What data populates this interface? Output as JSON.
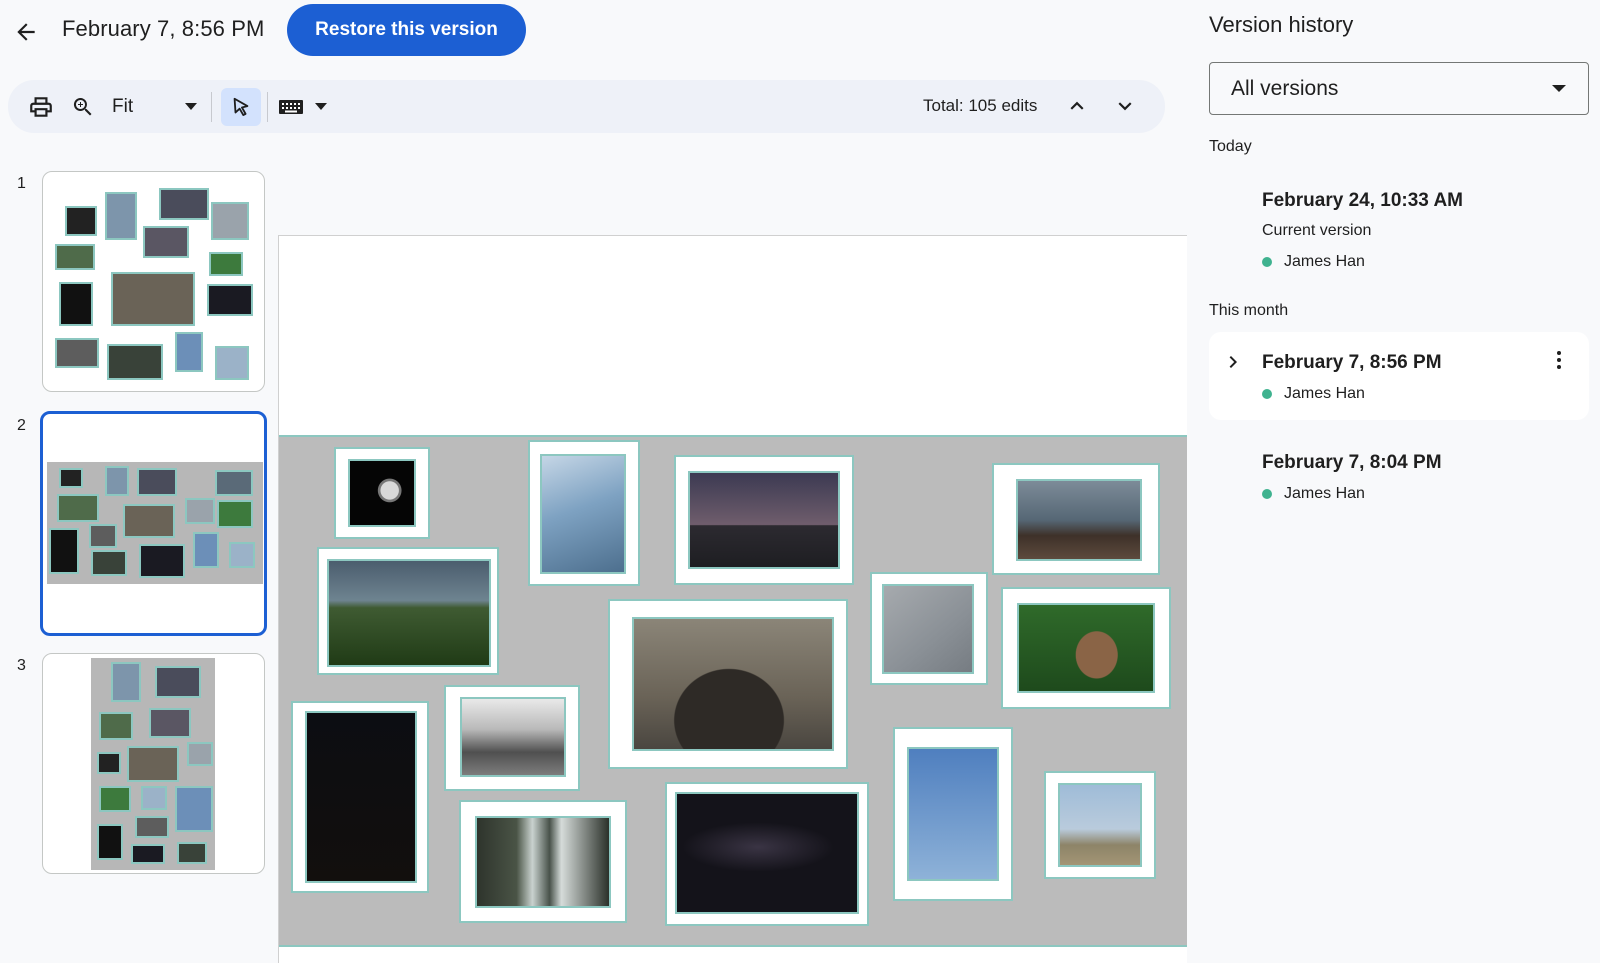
{
  "header": {
    "title": "February 7, 8:56 PM",
    "restore_label": "Restore this version"
  },
  "toolbar": {
    "zoom_label": "Fit",
    "total_edits": "Total: 105 edits",
    "icons": [
      "print-icon",
      "zoom-icon",
      "caret-down-icon",
      "cursor-icon",
      "keyboard-icon",
      "caret-down-icon",
      "chevron-up-icon",
      "chevron-down-icon"
    ]
  },
  "thumbnails": [
    {
      "number": "1"
    },
    {
      "number": "2"
    },
    {
      "number": "3"
    }
  ],
  "colors": {
    "accent": "#1c5fd3",
    "frame": "#8cc7c0",
    "user_dot": "#3fb28f",
    "select_bg": "#d3e2fd"
  },
  "panel": {
    "title": "Version history",
    "filter_value": "All versions",
    "sections": [
      {
        "label": "Today",
        "versions": [
          {
            "date": "February 24, 10:33 AM",
            "subtitle": "Current version",
            "user": "James Han"
          }
        ]
      },
      {
        "label": "This month",
        "versions": [
          {
            "date": "February 7, 8:56 PM",
            "user": "James Han"
          },
          {
            "date": "February 7, 8:04 PM",
            "user": "James Han"
          }
        ]
      }
    ]
  }
}
